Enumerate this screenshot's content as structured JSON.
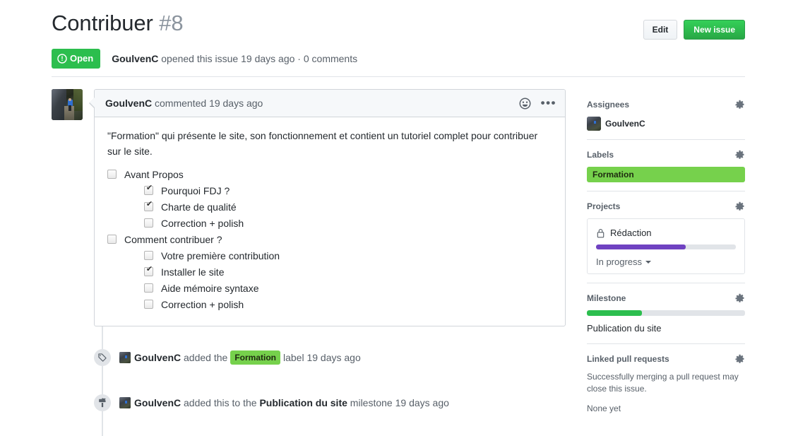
{
  "header": {
    "title": "Contribuer",
    "number": "#8",
    "edit_label": "Edit",
    "new_issue_label": "New issue",
    "state": "Open",
    "meta_author": "GoulvenC",
    "meta_opened": "opened this issue",
    "meta_time": "19 days ago",
    "meta_separator": "·",
    "meta_comments": "0 comments"
  },
  "comment": {
    "author": "GoulvenC",
    "action": "commented",
    "time": "19 days ago",
    "body_paragraph": "\"Formation\" qui présente le site, son fonctionnement et contient un tutoriel complet pour contribuer sur le site.",
    "tasks": [
      {
        "label": "Avant Propos",
        "checked": false,
        "children": [
          {
            "label": "Pourquoi FDJ ?",
            "checked": true
          },
          {
            "label": "Charte de qualité",
            "checked": true
          },
          {
            "label": "Correction + polish",
            "checked": false
          }
        ]
      },
      {
        "label": "Comment contribuer ?",
        "checked": false,
        "children": [
          {
            "label": "Votre première contribution",
            "checked": false
          },
          {
            "label": "Installer le site",
            "checked": true
          },
          {
            "label": "Aide mémoire syntaxe",
            "checked": false
          },
          {
            "label": "Correction + polish",
            "checked": false
          }
        ]
      }
    ]
  },
  "timeline": [
    {
      "icon": "tag-icon",
      "author": "GoulvenC",
      "pre": "added the",
      "chip": "Formation",
      "post": "label",
      "time": "19 days ago"
    },
    {
      "icon": "milestone-icon",
      "author": "GoulvenC",
      "pre": "added this to the",
      "strong": "Publication du site",
      "post": "milestone",
      "time": "19 days ago"
    }
  ],
  "sidebar": {
    "assignees": {
      "title": "Assignees",
      "user": "GoulvenC"
    },
    "labels": {
      "title": "Labels",
      "items": [
        {
          "name": "Formation",
          "color": "#76d14c"
        }
      ]
    },
    "projects": {
      "title": "Projects",
      "card": {
        "name": "Rédaction",
        "progress_percent": 64,
        "progress_color": "#6f42c1",
        "state": "In progress"
      }
    },
    "milestone": {
      "title": "Milestone",
      "progress_percent": 35,
      "progress_color": "#2cbe4e",
      "name": "Publication du site"
    },
    "linked_prs": {
      "title": "Linked pull requests",
      "note": "Successfully merging a pull request may close this issue.",
      "empty": "None yet"
    }
  },
  "colors": {
    "open_green": "#2cbe4e",
    "new_issue_green": "#28a745",
    "label_green": "#76d14c",
    "project_purple": "#6f42c1"
  }
}
